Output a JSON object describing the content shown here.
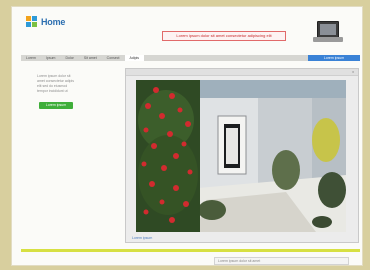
{
  "header": {
    "logo_text": "Home",
    "promo_text": "Lorem ipsum dolor sit amet consectetur adipiscing elit",
    "laptop_icon": "laptop-icon"
  },
  "navbar": {
    "tabs": [
      "Lorem",
      "Ipsum",
      "Dolor",
      "Sit amet",
      "Consect",
      "Adipis"
    ],
    "active_index": 5,
    "cta_label": "Lorem ipsum"
  },
  "sidebar": {
    "lines": [
      "Lorem ipsum dolor sit",
      "amet consectetur adipis",
      "elit sed do eiusmod",
      "tempor incididunt ut"
    ],
    "button_label": "Lorem ipsum"
  },
  "viewer": {
    "toolbar_text": "x",
    "status_text": "Lorem ipsum"
  },
  "footer": {
    "field_text": "Lorem ipsum dolor sit amet"
  },
  "colors": {
    "background": "#d8cf9e",
    "accent_blue": "#3a82d6",
    "accent_green": "#3fae3a",
    "promo_red": "#c7282a",
    "divider_yellow": "#d7e042"
  }
}
